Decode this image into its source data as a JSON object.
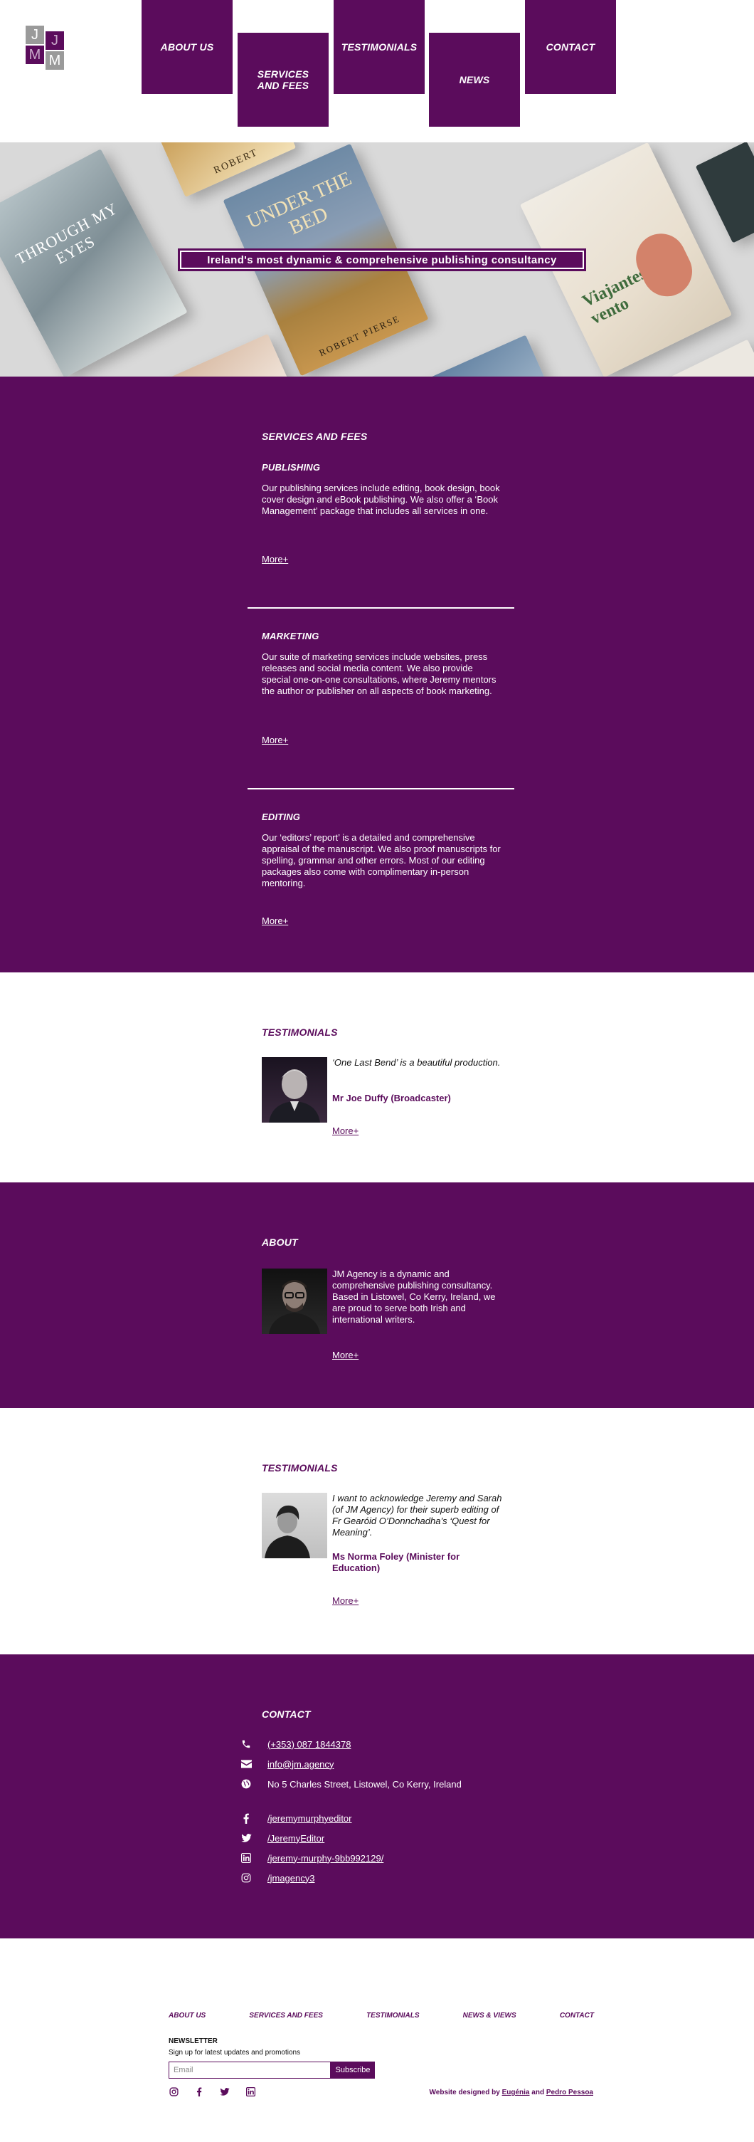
{
  "logo": {
    "letters": [
      "J",
      "J",
      "M",
      "M"
    ]
  },
  "nav": {
    "about": "ABOUT US",
    "services": "SERVICES AND FEES",
    "testimonials": "TESTIMONIALS",
    "news": "NEWS",
    "contact": "CONTACT"
  },
  "hero": {
    "banner": "Ireland's most dynamic & comprehensive publishing consultancy",
    "books": {
      "book1_title": "THROUGH MY EYES",
      "book2_title": "UNDER THE BED",
      "book2_author": "ROBERT PIERSE",
      "book2_top": "ROBERT",
      "book3_title": "Viajantes do vento"
    }
  },
  "services": {
    "title": "SERVICES AND FEES",
    "items": [
      {
        "heading": "PUBLISHING",
        "text": "Our publishing services include editing, book design, book cover design and eBook publishing. We also offer a ‘Book Management’ package that includes all services in one.",
        "more": "More+"
      },
      {
        "heading": "MARKETING",
        "text": "Our suite of marketing services include websites, press releases and social media content. We also provide special one-on-one consultations, where Jeremy mentors the author or publisher on all aspects of book marketing.",
        "more": "More+"
      },
      {
        "heading": "EDITING",
        "text": "Our ‘editors’ report’ is a detailed and comprehensive appraisal of the manuscript. We also proof manuscripts for spelling, grammar and other errors. Most of our editing packages also come with complimentary in-person mentoring.",
        "more": "More+"
      }
    ]
  },
  "testimonial1": {
    "title": "TESTIMONIALS",
    "quote": "‘One Last Bend’ is a beautiful production.",
    "author": "Mr Joe Duffy (Broadcaster)",
    "more": "More+"
  },
  "about": {
    "title": "ABOUT",
    "text": "JM Agency is a dynamic and comprehensive publishing consultancy. Based in Listowel, Co Kerry, Ireland, we are proud to serve both Irish and international writers.",
    "more": "More+"
  },
  "testimonial2": {
    "title": "TESTIMONIALS",
    "quote": "I want to acknowledge Jeremy and Sarah (of JM Agency) for their superb editing of Fr Gearóid O’Donnchadha’s ‘Quest for Meaning’.",
    "author": "Ms Norma Foley (Minister for Education)",
    "more": "More+"
  },
  "contact": {
    "title": "CONTACT",
    "phone": "(+353) 087 1844378",
    "email": "info@jm.agency",
    "address": "No 5 Charles Street, Listowel, Co Kerry, Ireland",
    "facebook": "/jeremymurphyeditor",
    "twitter": "/JeremyEditor",
    "linkedin": "/jeremy-murphy-9bb992129/",
    "instagram": "/jmagency3"
  },
  "footer": {
    "nav": [
      "ABOUT US",
      "SERVICES AND FEES",
      "TESTIMONIALS",
      "NEWS & VIEWS",
      "CONTACT"
    ],
    "newsletter_title": "NEWSLETTER",
    "newsletter_sub": "Sign up for latest updates and promotions",
    "email_placeholder": "Email",
    "subscribe": "Subscribe",
    "credit_prefix": "Website designed by",
    "credit_name1": "Eugénia",
    "credit_and": "and",
    "credit_name2": "Pedro Pessoa"
  },
  "colors": {
    "brand": "#5b0c5c",
    "grey": "#9a9a9a"
  }
}
